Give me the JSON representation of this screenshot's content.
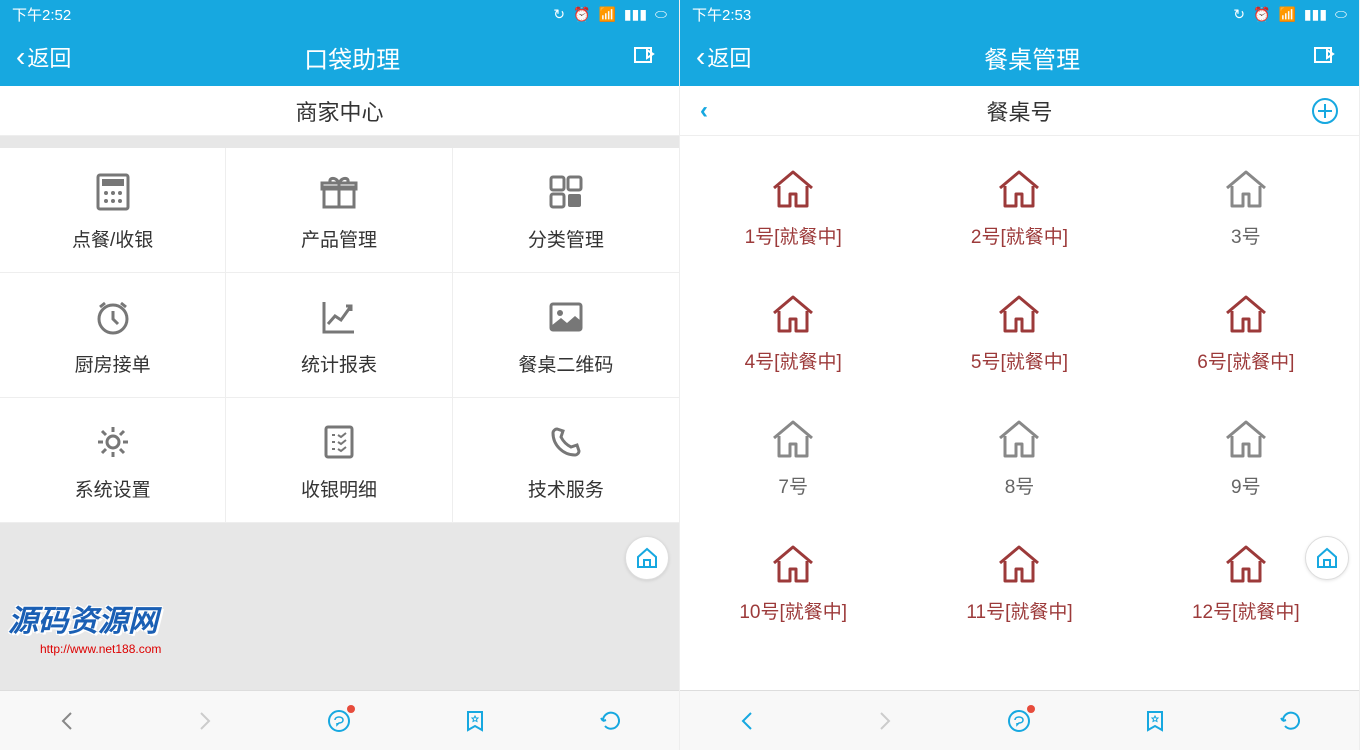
{
  "left": {
    "status_time": "下午2:52",
    "nav_back": "返回",
    "nav_title": "口袋助理",
    "sub_title": "商家中心",
    "items": [
      {
        "label": "点餐/收银",
        "icon": "calculator"
      },
      {
        "label": "产品管理",
        "icon": "gift"
      },
      {
        "label": "分类管理",
        "icon": "grid"
      },
      {
        "label": "厨房接单",
        "icon": "clock"
      },
      {
        "label": "统计报表",
        "icon": "chart"
      },
      {
        "label": "餐桌二维码",
        "icon": "image"
      },
      {
        "label": "系统设置",
        "icon": "gear"
      },
      {
        "label": "收银明细",
        "icon": "receipt"
      },
      {
        "label": "技术服务",
        "icon": "phone"
      }
    ]
  },
  "right": {
    "status_time": "下午2:53",
    "nav_back": "返回",
    "nav_title": "餐桌管理",
    "sub_title": "餐桌号",
    "tables": [
      {
        "n": "1",
        "busy": true
      },
      {
        "n": "2",
        "busy": true
      },
      {
        "n": "3",
        "busy": false
      },
      {
        "n": "4",
        "busy": true
      },
      {
        "n": "5",
        "busy": true
      },
      {
        "n": "6",
        "busy": true
      },
      {
        "n": "7",
        "busy": false
      },
      {
        "n": "8",
        "busy": false
      },
      {
        "n": "9",
        "busy": false
      },
      {
        "n": "10",
        "busy": true
      },
      {
        "n": "11",
        "busy": true
      },
      {
        "n": "12",
        "busy": true
      }
    ],
    "busy_suffix": "[就餐中]",
    "num_suffix": "号"
  },
  "watermark": "源码资源网",
  "watermark_url": "http://www.net188.com",
  "colors": {
    "accent": "#17a8e0",
    "busy": "#9c3a3a",
    "gray": "#777"
  }
}
